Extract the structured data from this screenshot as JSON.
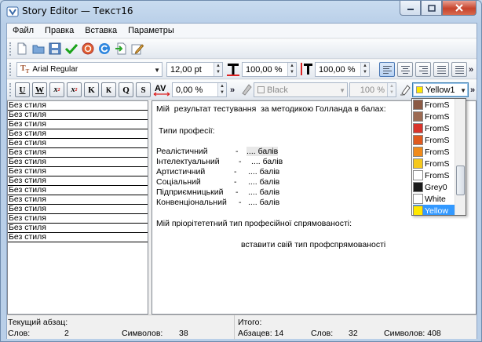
{
  "window": {
    "title": "Story Editor — Текст16"
  },
  "menu": [
    "Файл",
    "Правка",
    "Вставка",
    "Параметры"
  ],
  "toolbar2": {
    "font": "Arial Regular",
    "font_size": "12,00 pt",
    "scale_h": "100,00 %",
    "scale_v": "100,00 %"
  },
  "toolbar3": {
    "buttons": [
      "U",
      "W",
      "x",
      "x",
      "K",
      "K",
      "Q",
      "S"
    ],
    "tracking": "0,00 %",
    "color": "Black",
    "shade": "100 %",
    "highlight": "Yellow1"
  },
  "style_list": [
    "Без стиля",
    "Без стиля",
    "Без стиля",
    "Без стиля",
    "Без стиля",
    "Без стиля",
    "Без стиля",
    "Без стиля",
    "Без стиля",
    "Без стиля",
    "Без стиля",
    "Без стиля",
    "Без стиля",
    "Без стиля",
    "Без стиля"
  ],
  "editor": {
    "line1": "Мій  результат тестування  за методикою Голланда в балах:",
    "heading": "Типи професії:",
    "rows": [
      {
        "name": "Реалістичний",
        "dash": "-",
        "score": ".... балів"
      },
      {
        "name": "Інтелектуальний",
        "dash": "-",
        "score": ".... балів"
      },
      {
        "name": "Артистичний",
        "dash": "-",
        "score": ".... балів"
      },
      {
        "name": "Соціальний",
        "dash": "-",
        "score": ".... балів"
      },
      {
        "name": "Підприємницький",
        "dash": "-",
        "score": ".... балів"
      },
      {
        "name": "Конвенціональний",
        "dash": "-",
        "score": ".... балів"
      }
    ],
    "priority": "Мій пріорітететний тип професійної спрямованості:",
    "insert": "вставити свій тип профспрямованості"
  },
  "color_list": [
    {
      "label": "FromS",
      "color": "#8b5a44"
    },
    {
      "label": "FromS",
      "color": "#9c6a52"
    },
    {
      "label": "FromS",
      "color": "#d9342b"
    },
    {
      "label": "FromS",
      "color": "#e05a1e"
    },
    {
      "label": "FromS",
      "color": "#f08a1a"
    },
    {
      "label": "FromS",
      "color": "#f5c81e"
    },
    {
      "label": "FromS",
      "color": "#ffffff"
    },
    {
      "label": "Grey0",
      "color": "#1a1a1a"
    },
    {
      "label": "White",
      "color": "#ffffff"
    },
    {
      "label": "Yellow",
      "color": "#ffe800"
    }
  ],
  "status": {
    "current_para_label": "Текущий абзац:",
    "words_label": "Слов:",
    "words": "2",
    "chars_label": "Символов:",
    "chars": "38",
    "total_label": "Итого:",
    "paras_label": "Абзацев: 14",
    "total_words_label": "Слов:",
    "total_words": "32",
    "total_chars_label": "Символов: 408"
  },
  "accent": "#3399ff"
}
